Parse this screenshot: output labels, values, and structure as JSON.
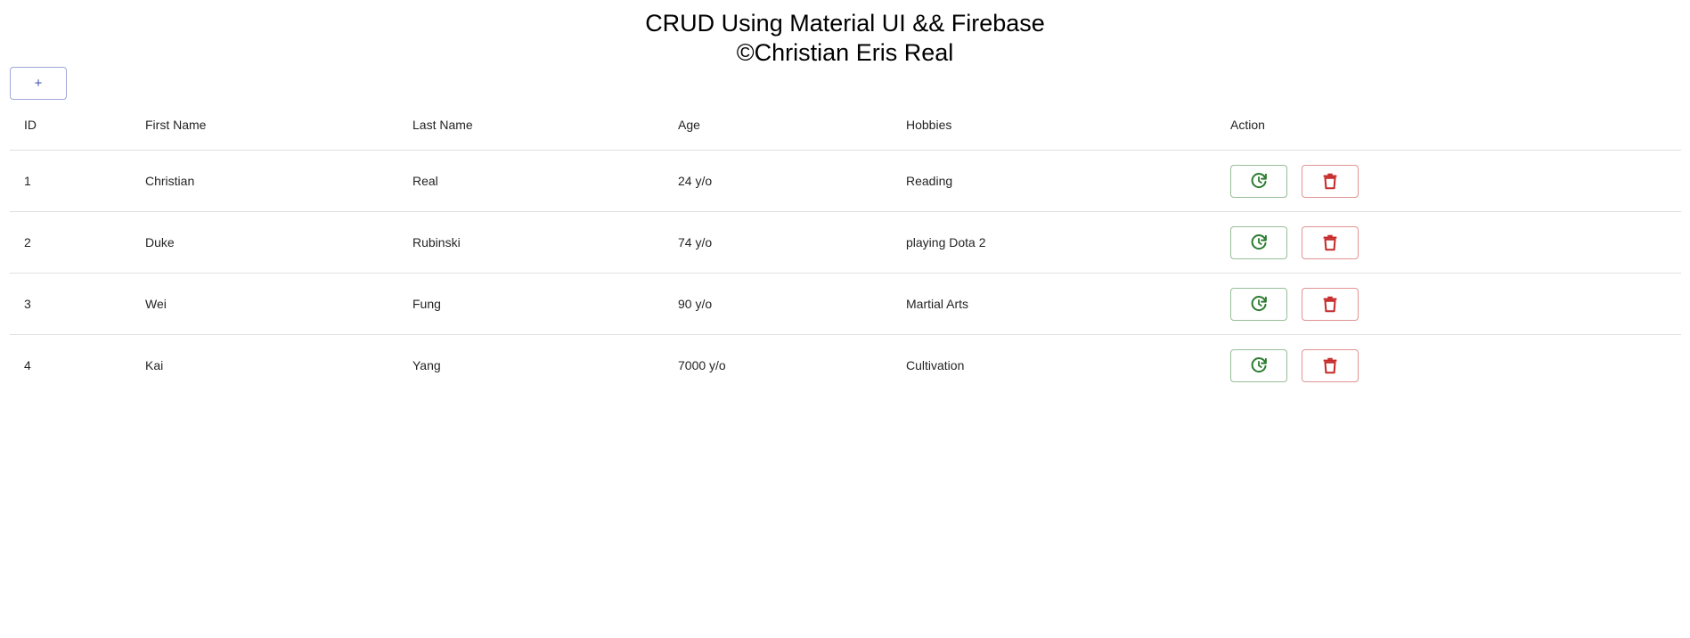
{
  "header": {
    "title": "CRUD Using Material UI && Firebase",
    "copyright": "©Christian Eris Real"
  },
  "toolbar": {
    "add_label": "+"
  },
  "table": {
    "columns": [
      "ID",
      "First Name",
      "Last Name",
      "Age",
      "Hobbies",
      "Action"
    ],
    "rows": [
      {
        "id": "1",
        "first_name": "Christian",
        "last_name": "Real",
        "age": "24 y/o",
        "hobbies": "Reading"
      },
      {
        "id": "2",
        "first_name": "Duke",
        "last_name": "Rubinski",
        "age": "74 y/o",
        "hobbies": "playing Dota 2"
      },
      {
        "id": "3",
        "first_name": "Wei",
        "last_name": "Fung",
        "age": "90 y/o",
        "hobbies": "Martial Arts"
      },
      {
        "id": "4",
        "first_name": "Kai",
        "last_name": "Yang",
        "age": "7000 y/o",
        "hobbies": "Cultivation"
      }
    ],
    "actions": {
      "update_icon": "refresh-icon",
      "delete_icon": "trash-icon"
    }
  },
  "colors": {
    "primary": "#3f51b5",
    "update": "#2e7d32",
    "delete": "#c62828",
    "divider": "#e0e0e0"
  }
}
